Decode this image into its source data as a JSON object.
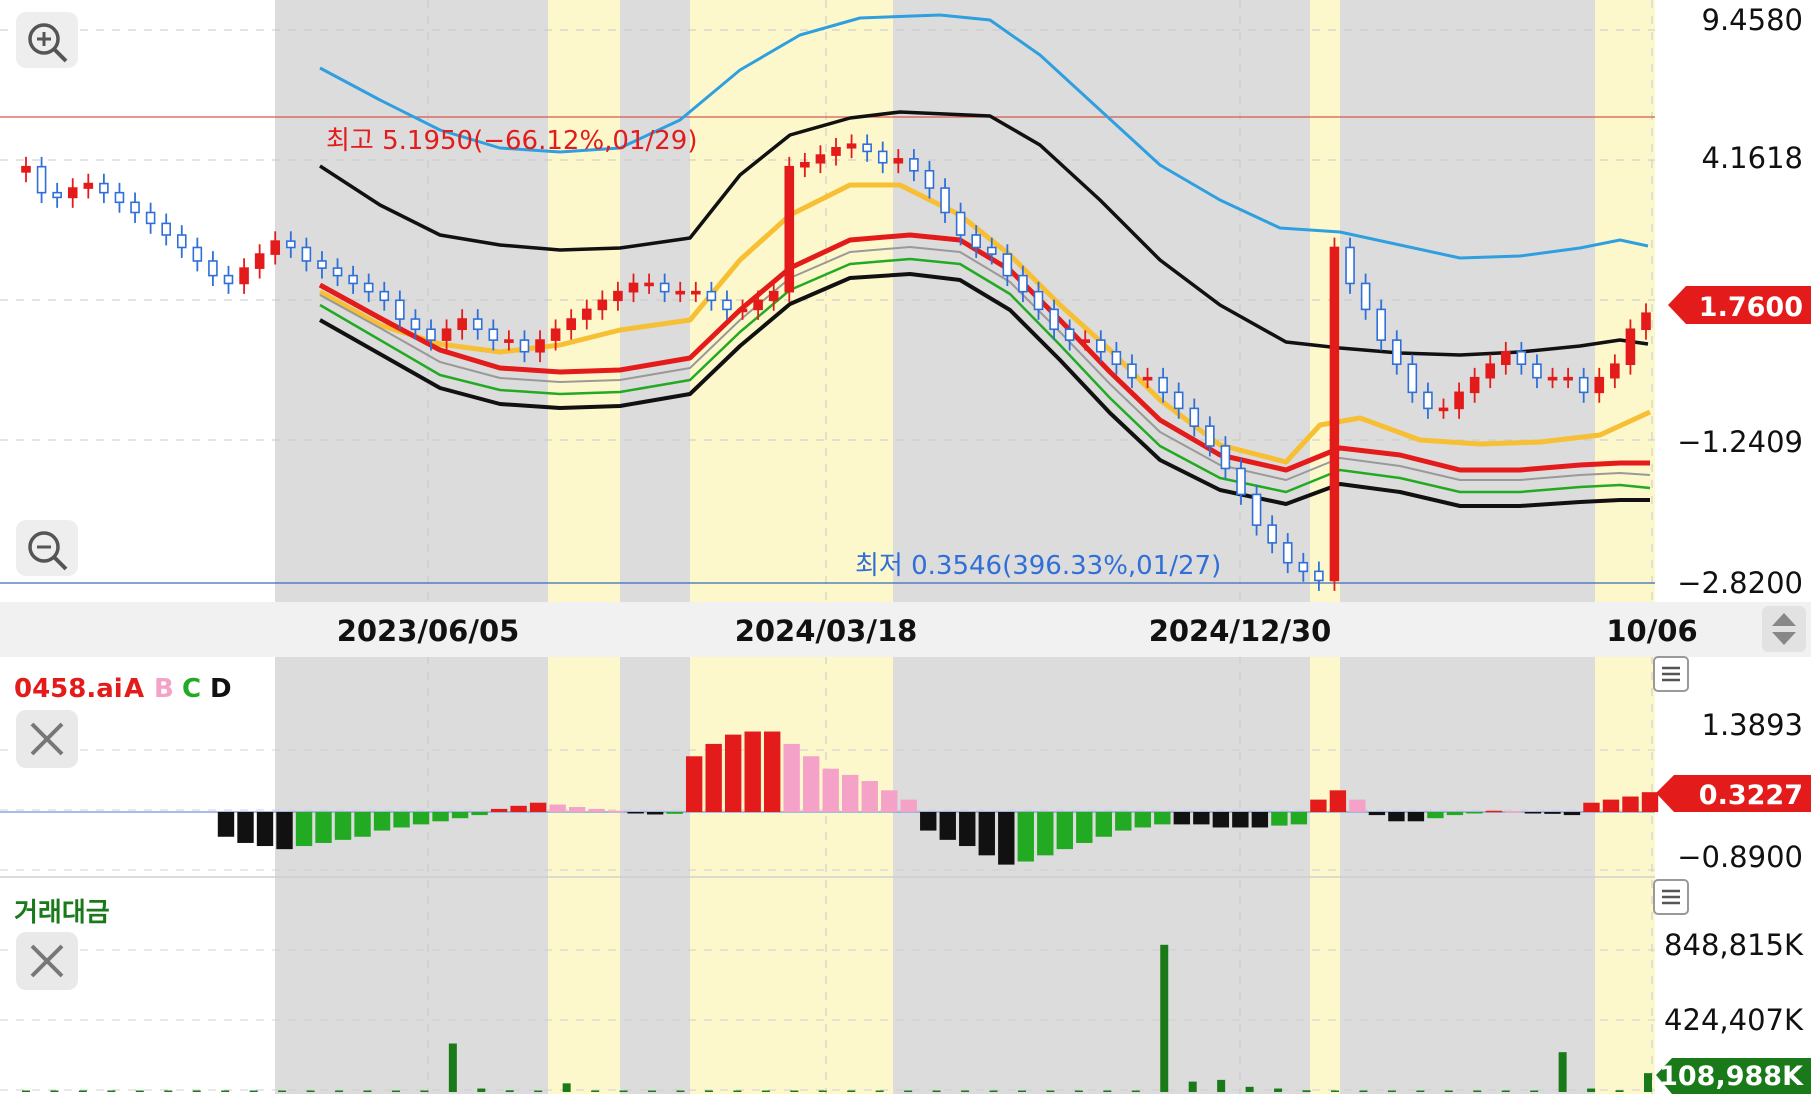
{
  "colors": {
    "up": "#e31b1b",
    "down": "#2f6fd8",
    "shade_gray": "#dcdcdc",
    "shade_yellow": "#fdf8cc",
    "price_badge": "#e31b1b",
    "volume": "#1a7a1a",
    "volume_badge": "#1a7a1a",
    "legend_a": "#e31b1b",
    "legend_b": "#f4a2c8",
    "legend_c": "#22aa22",
    "legend_d": "#111111"
  },
  "icons": {
    "zoom_in": "zoom-in-icon",
    "zoom_out": "zoom-out-icon",
    "close": "close-icon",
    "menu": "menu-icon",
    "scroll": "up-down-arrow-icon"
  },
  "x_axis": {
    "ticks": [
      "2023/06/05",
      "2024/03/18",
      "2024/12/30",
      "10/06"
    ]
  },
  "chart_data": [
    {
      "type": "candlestick",
      "panel": "price",
      "y_ticks": [
        "9.4580",
        "4.1618",
        "1.7600",
        "−1.2409",
        "−2.8200"
      ],
      "current_value": "1.7600",
      "annotations": {
        "high": "최고 5.1950(−66.12%,01/29)",
        "low": "최저 0.3546(396.33%,01/27)"
      },
      "ylim": [
        0.3546,
        9.458
      ],
      "approx_close": [
        4.2,
        3.6,
        3.5,
        3.7,
        3.8,
        3.6,
        3.4,
        3.2,
        3.0,
        2.8,
        2.6,
        2.4,
        2.2,
        2.1,
        2.3,
        2.5,
        2.7,
        2.6,
        2.4,
        2.3,
        2.2,
        2.1,
        2.0,
        1.9,
        1.7,
        1.6,
        1.5,
        1.6,
        1.7,
        1.6,
        1.5,
        1.5,
        1.4,
        1.5,
        1.6,
        1.7,
        1.8,
        1.9,
        2.0,
        2.1,
        2.1,
        2.0,
        2.0,
        2.0,
        1.9,
        1.8,
        1.8,
        1.9,
        2.0,
        4.2,
        4.3,
        4.5,
        4.7,
        4.8,
        4.6,
        4.3,
        4.4,
        4.1,
        3.7,
        3.2,
        2.8,
        2.6,
        2.5,
        2.2,
        2.0,
        1.8,
        1.6,
        1.5,
        1.5,
        1.4,
        1.3,
        1.2,
        1.2,
        1.1,
        1.0,
        0.9,
        0.8,
        0.7,
        0.6,
        0.5,
        0.45,
        0.4,
        0.38,
        0.36,
        2.6,
        2.1,
        1.8,
        1.5,
        1.3,
        1.1,
        1.0,
        1.0,
        1.1,
        1.2,
        1.3,
        1.4,
        1.3,
        1.2,
        1.2,
        1.2,
        1.1,
        1.2,
        1.3,
        1.6,
        1.76
      ]
    },
    {
      "type": "bar",
      "panel": "oscillator",
      "title": "0458.ai",
      "legend": [
        "A",
        "B",
        "C",
        "D"
      ],
      "y_ticks": [
        "1.3893",
        "0.3227",
        "−0.8900"
      ],
      "current_value": "0.3227",
      "ylim": [
        -0.89,
        1.3893
      ],
      "approx_values": [
        -0.4,
        -0.5,
        -0.55,
        -0.6,
        -0.55,
        -0.5,
        -0.45,
        -0.4,
        -0.3,
        -0.25,
        -0.2,
        -0.15,
        -0.1,
        -0.05,
        0.05,
        0.1,
        0.15,
        0.12,
        0.08,
        0.05,
        0.02,
        -0.02,
        -0.04,
        -0.03,
        0.9,
        1.1,
        1.25,
        1.3,
        1.3,
        1.1,
        0.9,
        0.7,
        0.6,
        0.5,
        0.35,
        0.2,
        -0.3,
        -0.45,
        -0.55,
        -0.7,
        -0.85,
        -0.8,
        -0.7,
        -0.6,
        -0.5,
        -0.4,
        -0.3,
        -0.25,
        -0.2,
        -0.2,
        -0.2,
        -0.25,
        -0.25,
        -0.25,
        -0.22,
        -0.2,
        0.2,
        0.35,
        0.2,
        -0.05,
        -0.15,
        -0.15,
        -0.1,
        -0.05,
        -0.02,
        0.02,
        0.01,
        -0.02,
        -0.03,
        -0.05,
        0.15,
        0.2,
        0.25,
        0.32
      ]
    },
    {
      "type": "bar",
      "panel": "volume",
      "title": "거래대금",
      "y_ticks": [
        "848,815K",
        "424,407K",
        "108,988K"
      ],
      "current_value": "108,988K",
      "ylim": [
        0,
        848815
      ],
      "approx_values": [
        4000,
        3000,
        5000,
        6000,
        4000,
        3000,
        2000,
        8000,
        5000,
        4000,
        3000,
        3000,
        6000,
        4000,
        3000,
        280000,
        20000,
        10000,
        6000,
        50000,
        8000,
        5000,
        4000,
        3000,
        4000,
        3000,
        5000,
        4000,
        2000,
        3000,
        3000,
        4000,
        6000,
        5000,
        4000,
        3000,
        8000,
        6000,
        5000,
        4000,
        850000,
        60000,
        70000,
        30000,
        20000,
        10000,
        5000,
        4000,
        3000,
        4000,
        3000,
        6000,
        5000,
        4000,
        230000,
        20000,
        10000,
        108988
      ]
    }
  ]
}
